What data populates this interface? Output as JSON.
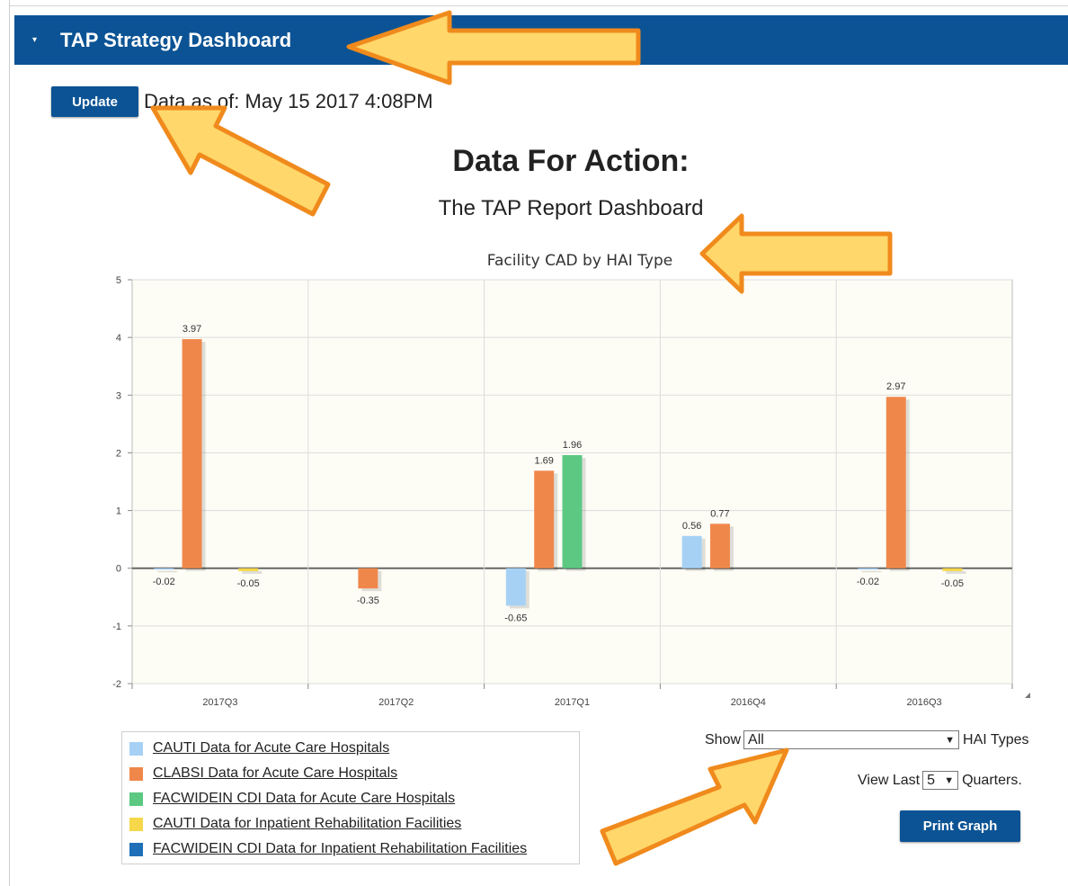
{
  "header": {
    "title": "TAP Strategy Dashboard",
    "caret": "▾"
  },
  "toolbar": {
    "update_label": "Update",
    "data_as_of": "Data as of: May 15 2017 4:08PM"
  },
  "report": {
    "main_title": "Data For Action:",
    "subtitle": "The TAP Report Dashboard"
  },
  "chart_data": {
    "type": "bar",
    "title": "Facility CAD by HAI Type",
    "xlabel": "",
    "ylabel": "",
    "ylim": [
      -2,
      5
    ],
    "yticks": [
      5,
      4,
      3,
      2,
      1,
      0,
      -1,
      -2
    ],
    "categories": [
      "2017Q3",
      "2017Q2",
      "2017Q1",
      "2016Q4",
      "2016Q3"
    ],
    "series": [
      {
        "name": "CAUTI Data for Acute Care Hospitals",
        "color": "#a6d1f5",
        "values": [
          -0.02,
          null,
          -0.65,
          0.56,
          -0.02
        ]
      },
      {
        "name": "CLABSI Data for Acute Care Hospitals",
        "color": "#f0874a",
        "values": [
          3.97,
          -0.35,
          1.69,
          0.77,
          2.97
        ]
      },
      {
        "name": "FACWIDEIN CDI Data for Acute Care Hospitals",
        "color": "#5cc882",
        "values": [
          null,
          null,
          1.96,
          null,
          null
        ]
      },
      {
        "name": "CAUTI Data for Inpatient Rehabilitation Facilities",
        "color": "#f6d84a",
        "values": [
          -0.05,
          null,
          null,
          null,
          -0.05
        ]
      },
      {
        "name": "FACWIDEIN CDI Data for Inpatient Rehabilitation Facilities",
        "color": "#1f6fb8",
        "values": [
          null,
          null,
          null,
          null,
          null
        ]
      }
    ],
    "grid": true,
    "legend_position": "bottom-left",
    "plot_background": "#fdfcf5"
  },
  "controls": {
    "show_label": "Show",
    "hai_selected": "All",
    "hai_suffix": "HAI Types",
    "view_last_label": "View Last",
    "quarters_selected": "5",
    "quarters_suffix": "Quarters.",
    "print_label": "Print Graph"
  },
  "colors": {
    "brand_blue": "#0b5394",
    "callout_fill": "#ffd76a",
    "callout_stroke": "#f08a1c"
  }
}
